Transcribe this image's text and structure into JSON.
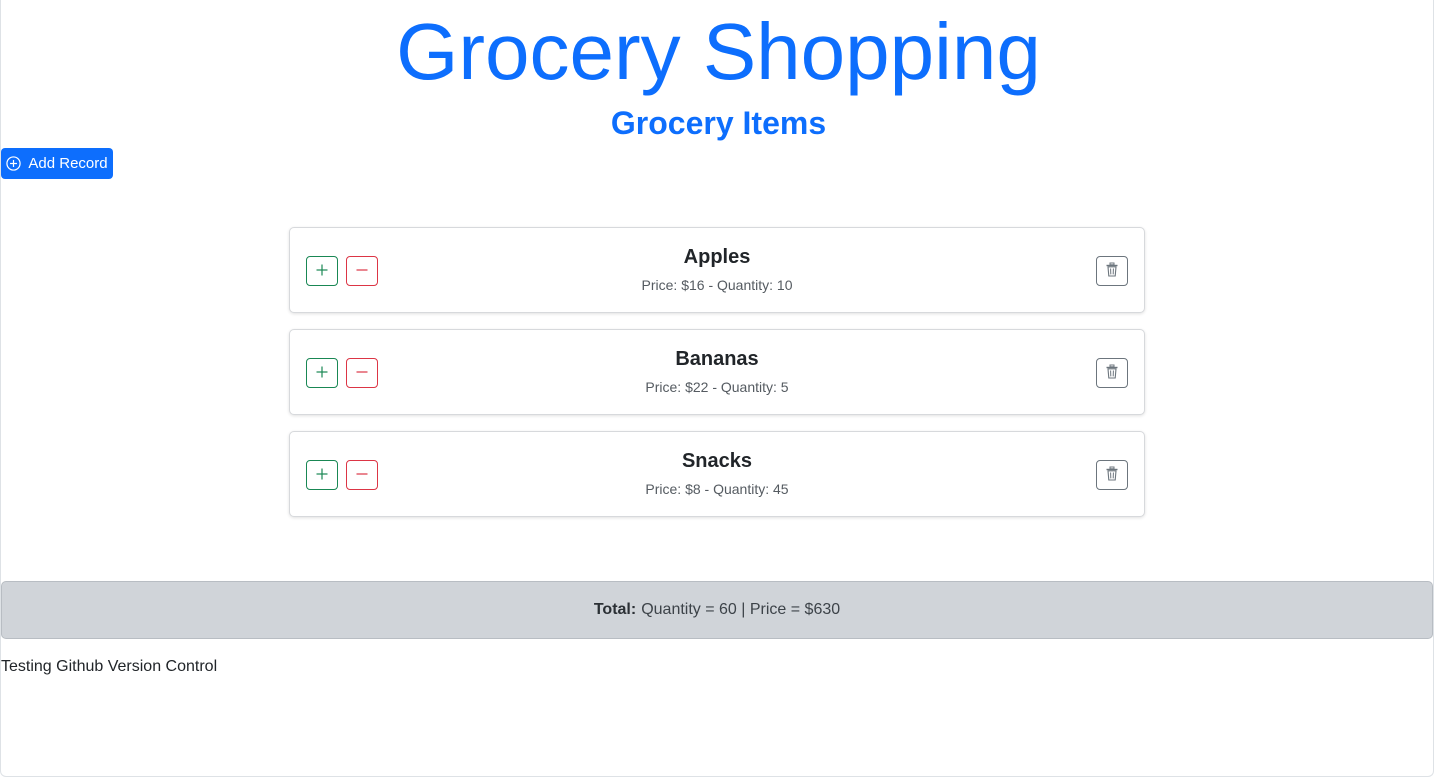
{
  "header": {
    "title": "Grocery Shopping",
    "subtitle": "Grocery Items"
  },
  "toolbar": {
    "add_label": "Add Record",
    "add_icon": "plus-circle-icon"
  },
  "items": [
    {
      "name": "Apples",
      "meta": "Price: $16 - Quantity: 10",
      "price": 16,
      "quantity": 10
    },
    {
      "name": "Bananas",
      "meta": "Price: $22 - Quantity: 5",
      "price": 22,
      "quantity": 5
    },
    {
      "name": "Snacks",
      "meta": "Price: $8 - Quantity: 45",
      "price": 8,
      "quantity": 45
    }
  ],
  "totals": {
    "label": "Total:",
    "text": "Quantity = 60 | Price = $630"
  },
  "footer": {
    "note": "Testing Github Version Control"
  },
  "colors": {
    "primary": "#0d6efd",
    "success": "#198754",
    "danger": "#dc3545",
    "secondary": "#6c757d",
    "total_bg": "#d0d4d9"
  }
}
